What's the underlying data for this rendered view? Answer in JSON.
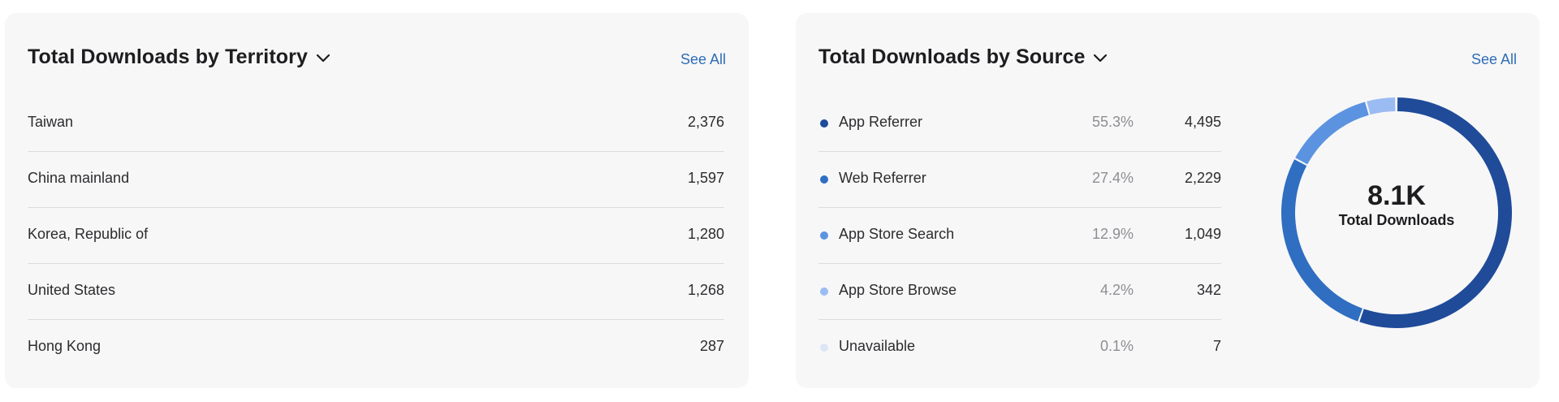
{
  "territory_card": {
    "title": "Total Downloads by Territory",
    "see_all": "See All",
    "rows": [
      {
        "name": "Taiwan",
        "value": "2,376"
      },
      {
        "name": "China mainland",
        "value": "1,597"
      },
      {
        "name": "Korea, Republic of",
        "value": "1,280"
      },
      {
        "name": "United States",
        "value": "1,268"
      },
      {
        "name": "Hong Kong",
        "value": "287"
      }
    ]
  },
  "source_card": {
    "title": "Total Downloads by Source",
    "see_all": "See All",
    "rows": [
      {
        "name": "App Referrer",
        "percent": "55.3%",
        "value": "4,495",
        "color": "#1f4b99"
      },
      {
        "name": "Web Referrer",
        "percent": "27.4%",
        "value": "2,229",
        "color": "#2f6ec1"
      },
      {
        "name": "App Store Search",
        "percent": "12.9%",
        "value": "1,049",
        "color": "#5b93e0"
      },
      {
        "name": "App Store Browse",
        "percent": "4.2%",
        "value": "342",
        "color": "#9bbcf2"
      },
      {
        "name": "Unavailable",
        "percent": "0.1%",
        "value": "7",
        "color": "#dce6f6"
      }
    ],
    "donut": {
      "total_value": "8.1K",
      "total_label": "Total Downloads"
    }
  },
  "chart_data": {
    "type": "pie",
    "categories": [
      "App Referrer",
      "Web Referrer",
      "App Store Search",
      "App Store Browse",
      "Unavailable"
    ],
    "values": [
      4495,
      2229,
      1049,
      342,
      7
    ],
    "percentages": [
      55.3,
      27.4,
      12.9,
      4.2,
      0.1
    ],
    "colors": [
      "#1f4b99",
      "#2f6ec1",
      "#5b93e0",
      "#9bbcf2",
      "#dce6f6"
    ],
    "title": "Total Downloads by Source"
  }
}
